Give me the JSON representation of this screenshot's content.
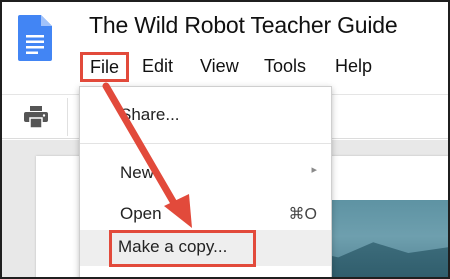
{
  "document": {
    "title": "The Wild Robot Teacher Guide"
  },
  "menubar": {
    "items": [
      "File",
      "Edit",
      "View",
      "Tools",
      "Help"
    ]
  },
  "toolbar": {
    "print_icon": "print-icon"
  },
  "file_menu": {
    "items": [
      {
        "label": "Share..."
      },
      {
        "label": "New",
        "right": "▸"
      },
      {
        "label": "Open",
        "right": "⌘O"
      },
      {
        "label": "Make a copy..."
      }
    ]
  },
  "colors": {
    "highlight": "#e24a3b",
    "docs_blue": "#4285f4"
  }
}
